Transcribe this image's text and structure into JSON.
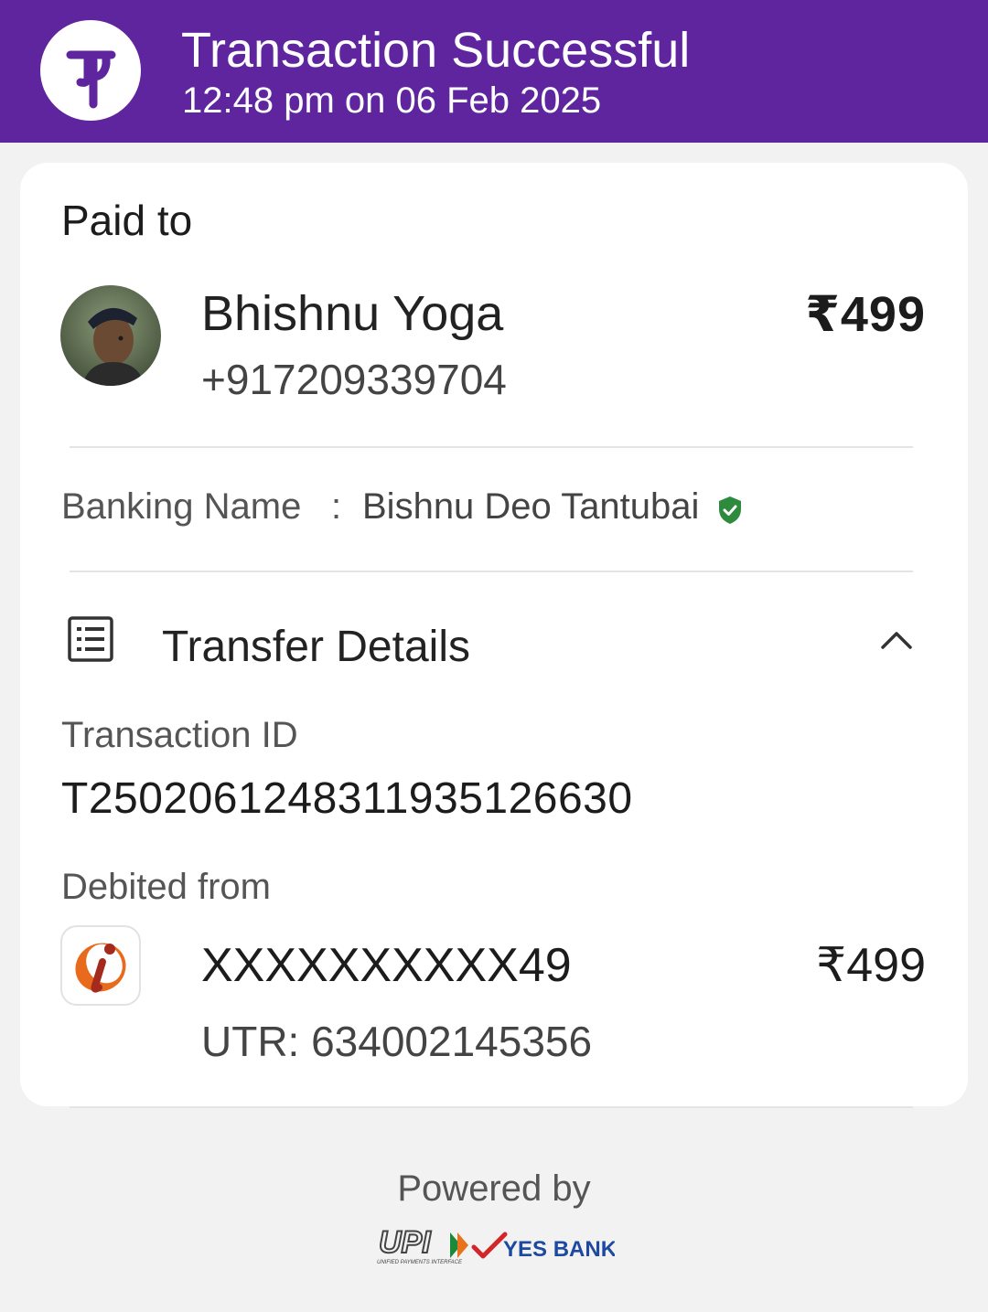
{
  "header": {
    "app_logo_icon": "phonepe-logo-icon",
    "title": "Transaction Successful",
    "timestamp": "12:48 pm on 06 Feb 2025",
    "background_color": "#5f259f"
  },
  "payment": {
    "paid_to_label": "Paid to",
    "payee_name": "Bhishnu Yoga",
    "payee_phone": "+917209339704",
    "amount": "₹499"
  },
  "banking_name": {
    "label": "Banking Name",
    "separator": ":",
    "value": "Bishnu Deo Tantubai",
    "verified_icon": "verified-shield-icon",
    "verified_color": "#2e8b3e"
  },
  "transfer_details": {
    "label": "Transfer Details",
    "icon": "receipt-list-icon",
    "toggle_icon": "chevron-up-icon",
    "transaction_id_label": "Transaction ID",
    "transaction_id": "T2502061248311935126630",
    "debited_from_label": "Debited from",
    "bank_icon": "icici-bank-logo-icon",
    "account_number": "XXXXXXXXXX49",
    "debited_amount": "₹499",
    "utr": "UTR: 634002145356"
  },
  "footer": {
    "powered_by": "Powered by",
    "upi_logo_text": "UPI",
    "upi_tagline": "UNIFIED PAYMENTS INTERFACE",
    "bank_partner": "YES BANK"
  }
}
